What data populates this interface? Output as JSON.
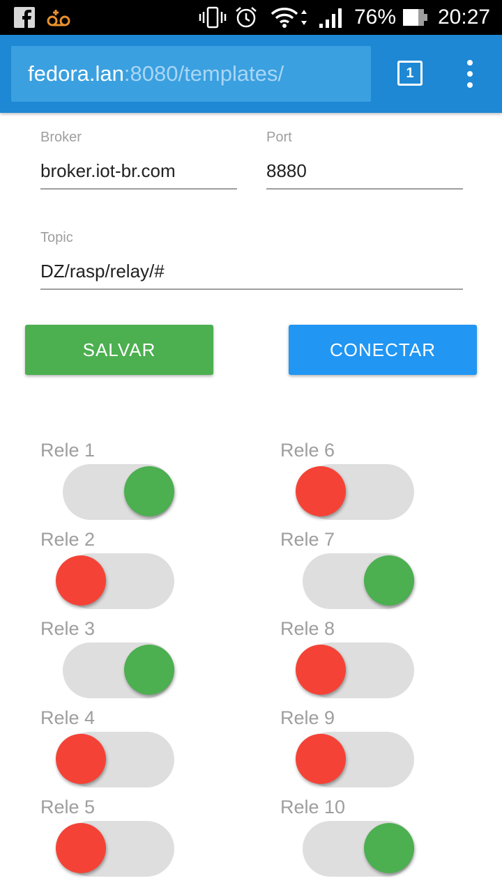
{
  "status_bar": {
    "battery_pct": "76%",
    "time": "20:27",
    "icons": [
      "facebook-icon",
      "voicemail-icon",
      "vibrate-icon",
      "alarm-icon",
      "wifi-icon",
      "signal-icon",
      "battery-icon"
    ]
  },
  "browser": {
    "url_host": "fedora.lan",
    "url_rest": ":8080/templates/",
    "tab_count": "1"
  },
  "form": {
    "broker_label": "Broker",
    "broker_value": "broker.iot-br.com",
    "port_label": "Port",
    "port_value": "8880",
    "topic_label": "Topic",
    "topic_value": "DZ/rasp/relay/#"
  },
  "buttons": {
    "save": "SALVAR",
    "connect": "CONECTAR"
  },
  "colors": {
    "on": "#4caf50",
    "off": "#f44336",
    "accent": "#2196f3",
    "toolbar": "#1e88d4"
  },
  "relays": [
    {
      "label": "Rele 1",
      "state": "on"
    },
    {
      "label": "Rele 2",
      "state": "off"
    },
    {
      "label": "Rele 3",
      "state": "on"
    },
    {
      "label": "Rele 4",
      "state": "off"
    },
    {
      "label": "Rele 5",
      "state": "off"
    },
    {
      "label": "Rele 6",
      "state": "off"
    },
    {
      "label": "Rele 7",
      "state": "on"
    },
    {
      "label": "Rele 8",
      "state": "off"
    },
    {
      "label": "Rele 9",
      "state": "off"
    },
    {
      "label": "Rele 10",
      "state": "on"
    }
  ]
}
